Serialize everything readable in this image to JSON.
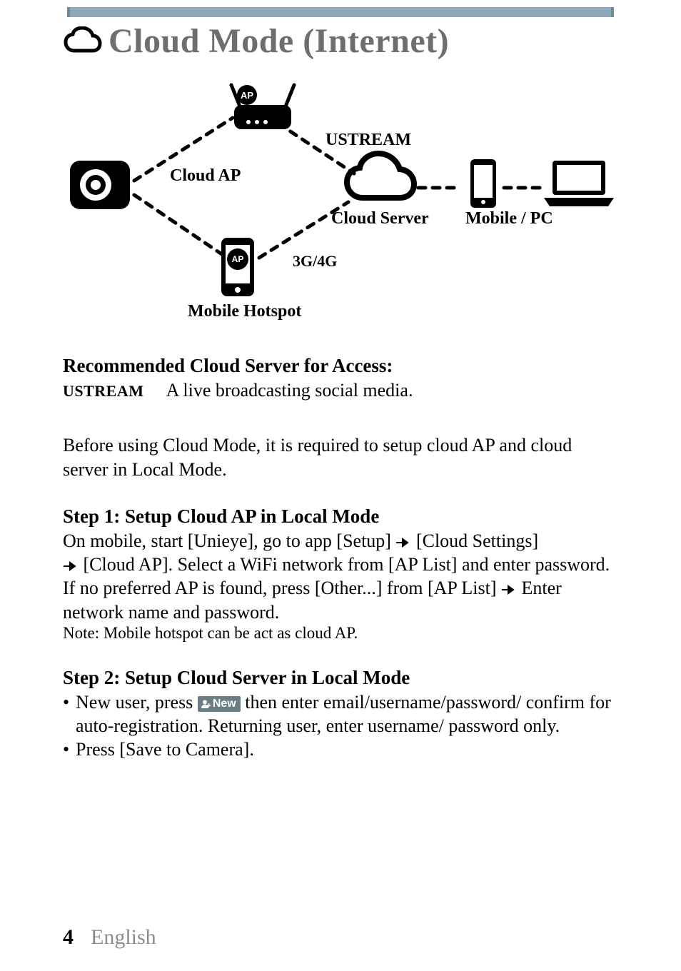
{
  "title": "Cloud Mode (Internet)",
  "diagram": {
    "ap_badge": "AP",
    "cloud_ap": "Cloud AP",
    "ustream": "USTREAM",
    "cloud_server": "Cloud Server",
    "mobile_pc": "Mobile / PC",
    "three_g": "3G/4G",
    "mobile_hotspot": "Mobile Hotspot"
  },
  "recommended": {
    "heading": "Recommended Cloud Server for Access:",
    "label": "USTREAM",
    "desc": "A live broadcasting social media."
  },
  "intro": "Before using Cloud Mode, it is required to setup cloud AP and cloud server in Local Mode.",
  "step1": {
    "heading": "Step 1: Setup Cloud AP in Local Mode",
    "p1a": "On mobile, start [Unieye], go to app [Setup]",
    "p1b": "[Cloud Settings]",
    "p2a": "[Cloud AP].  Select a WiFi network from [AP List] and enter password.  If no preferred AP is found, press [Other...] from [AP List]",
    "p2b": "Enter network name and password.",
    "note": "Note: Mobile hotspot can be act as cloud AP."
  },
  "step2": {
    "heading": "Step 2: Setup Cloud Server in Local Mode",
    "b1a": "New user, press ",
    "new_label": "New",
    "b1b": " then enter email/username/password/ confirm for auto-registration. Returning user, enter username/ password only.",
    "b2": "Press [Save to Camera]."
  },
  "footer": {
    "page": "4",
    "lang": "English"
  }
}
